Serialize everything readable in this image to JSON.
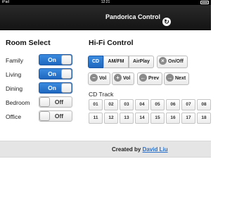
{
  "status_bar": {
    "device": "iPad",
    "time": "12:21"
  },
  "header": {
    "title": "Pandorica Control",
    "refresh_icon": "refresh-icon"
  },
  "room_select": {
    "heading": "Room Select",
    "rooms": [
      {
        "label": "Family",
        "state": "On"
      },
      {
        "label": "Living",
        "state": "On"
      },
      {
        "label": "Dining",
        "state": "On"
      },
      {
        "label": "Bedroom",
        "state": "Off"
      },
      {
        "label": "Office",
        "state": "Off"
      }
    ]
  },
  "hifi": {
    "heading": "Hi-Fi Control",
    "sources": [
      {
        "label": "CD",
        "active": true
      },
      {
        "label": "AM/FM",
        "active": false
      },
      {
        "label": "AirPlay",
        "active": false
      }
    ],
    "power_label": "On/Off",
    "vol_down_label": "Vol",
    "vol_up_label": "Vol",
    "prev_label": "Prev",
    "next_label": "Next",
    "track_label": "CD Track",
    "tracks": [
      "01",
      "02",
      "03",
      "04",
      "05",
      "06",
      "07",
      "08",
      "11",
      "12",
      "13",
      "14",
      "15",
      "16",
      "17",
      "18"
    ]
  },
  "footer": {
    "prefix": "Created by",
    "author": "David Liu"
  },
  "colors": {
    "accent": "#2a7ad5",
    "nav_bg": "#1e1e1e",
    "footer_bg": "#e5e5e5",
    "link": "#2a6fc9"
  }
}
